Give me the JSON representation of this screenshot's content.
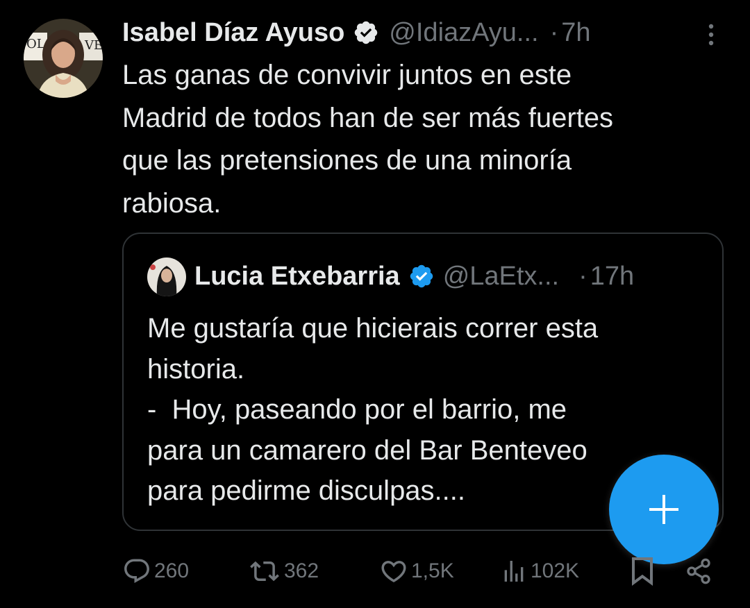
{
  "tweet": {
    "author_name": "Isabel Díaz Ayuso",
    "handle": "@IdiazAyu...",
    "separator": "·",
    "time": "7h",
    "text_lines": [
      "Las ganas de convivir juntos en este",
      "Madrid de todos han de ser más fuertes",
      "que las pretensiones de una minoría",
      "rabiosa."
    ]
  },
  "quote": {
    "author_name": "Lucia Etxebarria",
    "handle": "@LaEtx...",
    "separator": "·",
    "time": "17h",
    "text_lines": [
      "Me gustaría que hicierais correr esta",
      "historia.",
      "-  Hoy, paseando por el barrio, me",
      "para un camarero del Bar Benteveo",
      "para pedirme disculpas...."
    ]
  },
  "actions": {
    "replies": "260",
    "retweets": "362",
    "likes": "1,5K",
    "views": "102K"
  },
  "icons": {
    "verified": "verified-badge-icon",
    "more": "more-vertical-icon",
    "reply": "reply-icon",
    "retweet": "retweet-icon",
    "like": "heart-icon",
    "views": "views-icon",
    "bookmark": "bookmark-icon",
    "share": "share-icon",
    "compose": "plus-icon"
  },
  "colors": {
    "background": "#000000",
    "text": "#e7e9ea",
    "muted": "#71767b",
    "accent": "#1d9bf0",
    "border": "#2f3336"
  }
}
